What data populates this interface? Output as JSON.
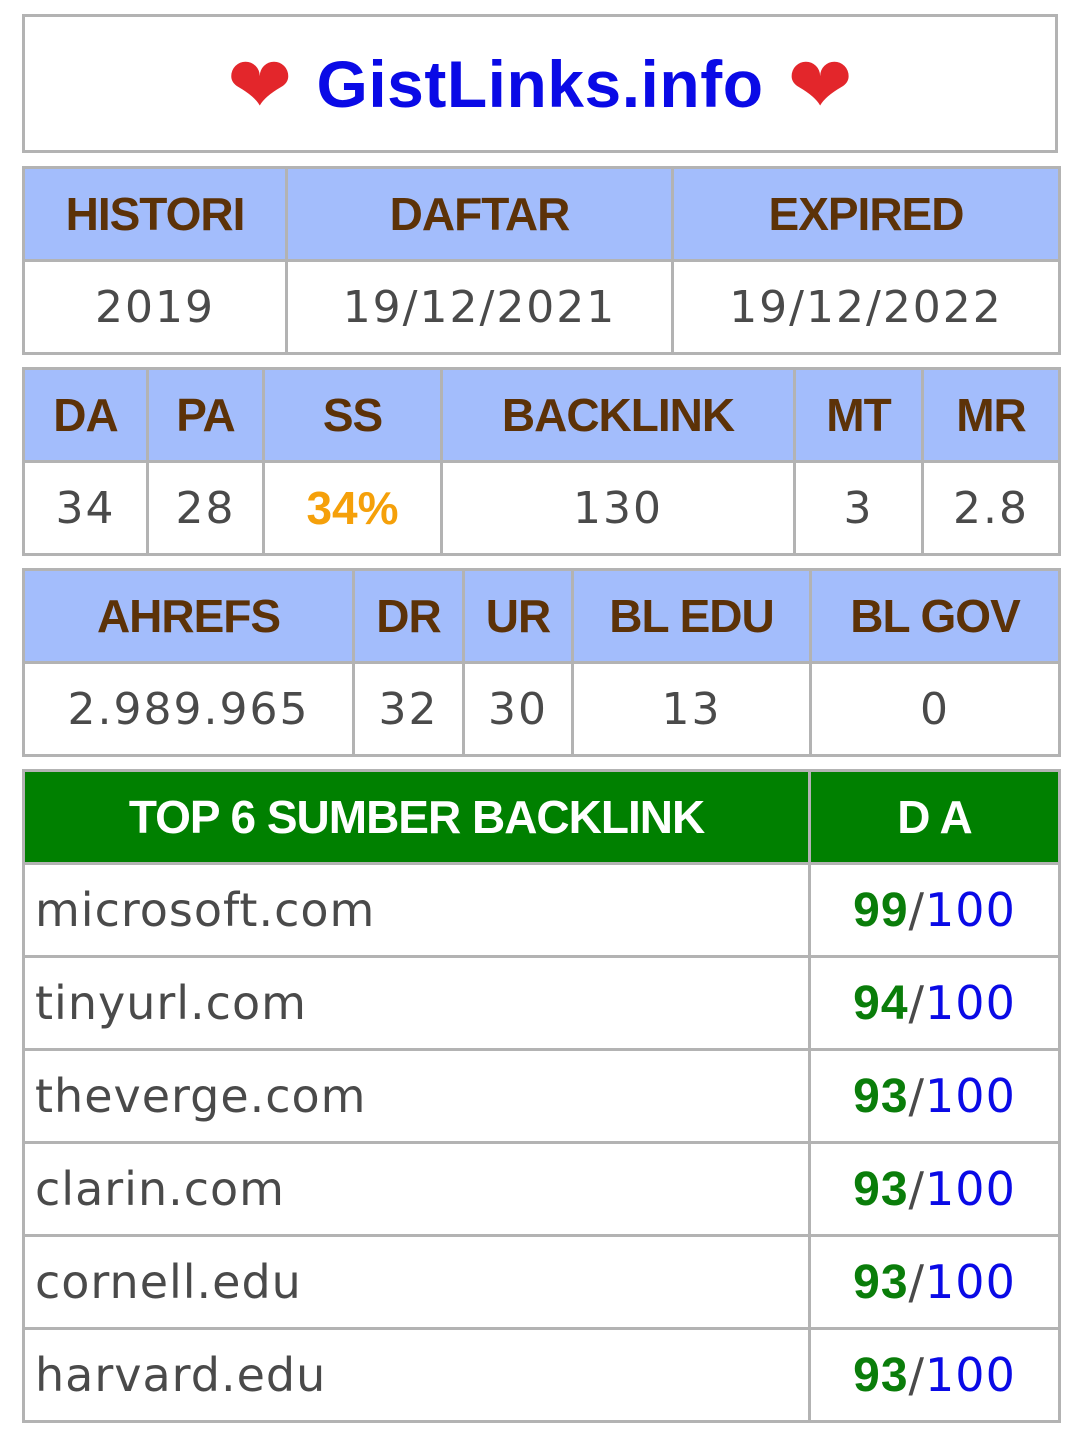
{
  "header": {
    "title": "GistLinks.info",
    "heart_glyph": "❤",
    "heart_color": "#e3262b",
    "title_color": "#0a0ae6"
  },
  "dates": {
    "headers": [
      "HISTORI",
      "DAFTAR",
      "EXPIRED"
    ],
    "values": [
      "2019",
      "19/12/2021",
      "19/12/2022"
    ]
  },
  "moz": {
    "headers": [
      "DA",
      "PA",
      "SS",
      "BACKLINK",
      "MT",
      "MR"
    ],
    "values": [
      "34",
      "28",
      "34%",
      "130",
      "3",
      "2.8"
    ],
    "ss_color": "#f5a00a"
  },
  "ahrefs": {
    "headers": [
      "AHREFS",
      "DR",
      "UR",
      "BL EDU",
      "BL GOV"
    ],
    "values": [
      "2.989.965",
      "32",
      "30",
      "13",
      "0"
    ]
  },
  "backlinks": {
    "header_source": "TOP 6 SUMBER BACKLINK",
    "header_da": "D A",
    "header_bg": "#008000",
    "rows": [
      {
        "domain": "microsoft.com",
        "da": "99",
        "sep": "/",
        "max": "100"
      },
      {
        "domain": "tinyurl.com",
        "da": "94",
        "sep": "/",
        "max": "100"
      },
      {
        "domain": "theverge.com",
        "da": "93",
        "sep": "/",
        "max": "100"
      },
      {
        "domain": "clarin.com",
        "da": "93",
        "sep": "/",
        "max": "100"
      },
      {
        "domain": "cornell.edu",
        "da": "93",
        "sep": "/",
        "max": "100"
      },
      {
        "domain": "harvard.edu",
        "da": "93",
        "sep": "/",
        "max": "100"
      }
    ]
  },
  "colors": {
    "table_header_bg": "#a3bdfc",
    "table_header_text": "#5c3208",
    "border": "#b3b3b3",
    "score_green": "#0a7d0a",
    "score_blue": "#0a0ae6"
  }
}
